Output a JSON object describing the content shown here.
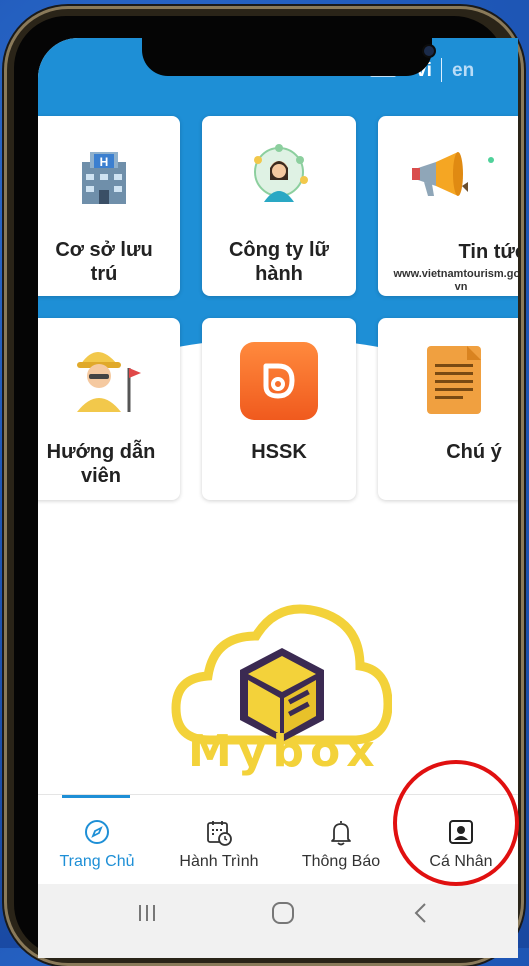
{
  "header": {
    "lang_vi": "vi",
    "lang_en": "en"
  },
  "menu": {
    "items": [
      {
        "label": "Cơ sở lưu trú",
        "icon": "hotel-building-icon"
      },
      {
        "label": "Công ty lữ hành",
        "icon": "travel-agent-globe-icon"
      },
      {
        "label": "Tin tức",
        "sub": "www.vietnamtourism.gov.vn",
        "icon": "megaphone-icon"
      },
      {
        "label": "Hướng dẫn viên",
        "icon": "tour-guide-icon"
      },
      {
        "label": "HSSK",
        "icon": "hssk-app-icon"
      },
      {
        "label": "Chú ý",
        "icon": "notes-icon"
      }
    ]
  },
  "banner": {
    "brand": "Mybox"
  },
  "tabbar": {
    "tabs": [
      {
        "label": "Trang Chủ",
        "icon": "compass-icon",
        "active": true
      },
      {
        "label": "Hành Trình",
        "icon": "calendar-clock-icon",
        "active": false
      },
      {
        "label": "Thông Báo",
        "icon": "bell-icon",
        "active": false
      },
      {
        "label": "Cá Nhân",
        "icon": "person-card-icon",
        "active": false
      }
    ]
  },
  "colors": {
    "primary": "#1e8fd6",
    "highlight": "#e01010",
    "brand_yellow": "#f3d23a"
  }
}
